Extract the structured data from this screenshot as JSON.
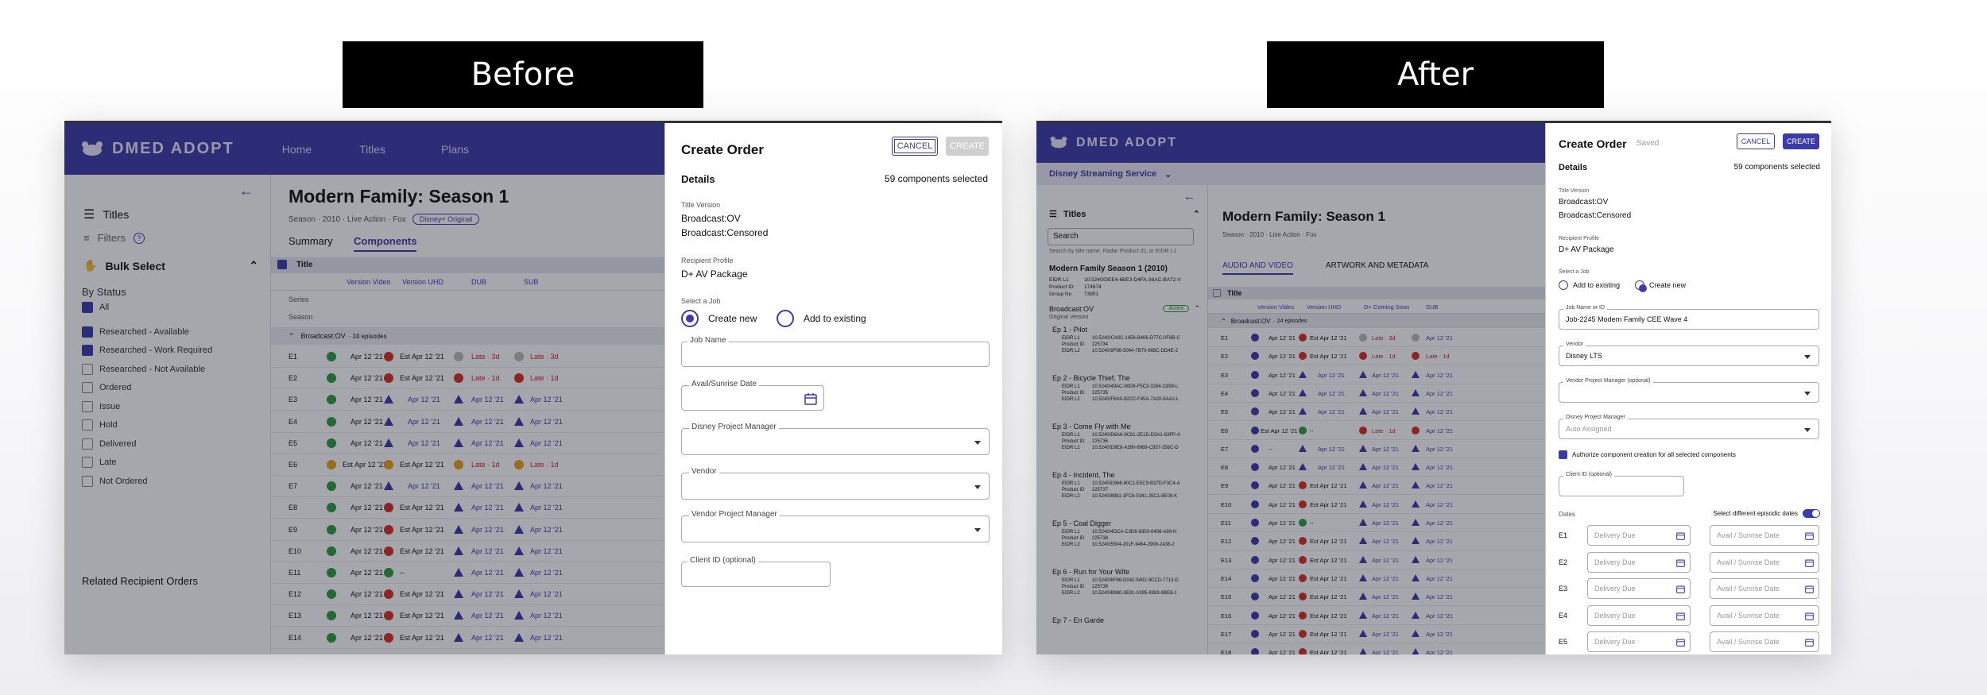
{
  "labels": {
    "before": "Before",
    "after": "After"
  },
  "colors": {
    "brand": "#3d3ba8",
    "ok": "#2a9d3a",
    "err": "#d93025",
    "warn": "#e8a317",
    "late": "#c62828"
  },
  "before": {
    "app_name": "DMED ADOPT",
    "nav": [
      "Home",
      "Titles",
      "Plans"
    ],
    "sidebar": {
      "titles": "Titles",
      "filters": "Filters",
      "bulk_select": "Bulk Select",
      "by_status": "By Status",
      "statuses": [
        {
          "label": "All",
          "checked": true
        },
        {
          "label": "Researched - Available",
          "checked": true
        },
        {
          "label": "Researched - Work Required",
          "checked": true
        },
        {
          "label": "Researched - Not Available",
          "checked": false
        },
        {
          "label": "Ordered",
          "checked": false
        },
        {
          "label": "Issue",
          "checked": false
        },
        {
          "label": "Hold",
          "checked": false
        },
        {
          "label": "Delivered",
          "checked": false
        },
        {
          "label": "Late",
          "checked": false
        },
        {
          "label": "Not Ordered",
          "checked": false
        }
      ],
      "related": "Related Recipient Orders"
    },
    "main": {
      "title": "Modern Family: Season 1",
      "meta": "Season · 2010 · Live Action · Fox",
      "badge": "Disney+ Original",
      "tabs": [
        "Summary",
        "Components"
      ],
      "col_title": "Title",
      "columns": [
        "Version Video",
        "Version UHD",
        "DUB",
        "SUB"
      ],
      "series": "Series",
      "season": "Season",
      "group": "Broadcast:OV",
      "group_count": "· 24 episodes",
      "rows": [
        {
          "ep": "E1",
          "video": "Apr 12 '21",
          "uhd": "Est Apr 12 '21",
          "dub": "Late · 3d",
          "sub": "Late · 3d",
          "vs": "ok",
          "us": "err",
          "ds": "grey"
        },
        {
          "ep": "E2",
          "video": "Apr 12 '21",
          "uhd": "Est Apr 12 '21",
          "dub": "Late · 1d",
          "sub": "Late · 1d",
          "vs": "ok",
          "us": "err",
          "ds": "err"
        },
        {
          "ep": "E3",
          "video": "Apr 12 '21",
          "uhd": "Apr 12 '21",
          "dub": "Apr 12 '21",
          "sub": "Apr 12 '21",
          "vs": "ok",
          "us": "tri",
          "ds": "tri"
        },
        {
          "ep": "E4",
          "video": "Apr 12 '21",
          "uhd": "Apr 12 '21",
          "dub": "Apr 12 '21",
          "sub": "Apr 12 '21",
          "vs": "ok",
          "us": "tri",
          "ds": "tri"
        },
        {
          "ep": "E5",
          "video": "Apr 12 '21",
          "uhd": "Apr 12 '21",
          "dub": "Apr 12 '21",
          "sub": "Apr 12 '21",
          "vs": "ok",
          "us": "tri",
          "ds": "tri"
        },
        {
          "ep": "E6",
          "video": "Est Apr 12 '21",
          "uhd": "Est Apr 12 '21",
          "dub": "Late · 1d",
          "sub": "Late · 1d",
          "vs": "warn",
          "us": "warn",
          "ds": "warn"
        },
        {
          "ep": "E7",
          "video": "Apr 12 '21",
          "uhd": "Apr 12 '21",
          "dub": "Apr 12 '21",
          "sub": "Apr 12 '21",
          "vs": "ok",
          "us": "tri",
          "ds": "tri"
        },
        {
          "ep": "E8",
          "video": "Apr 12 '21",
          "uhd": "Est Apr 12 '21",
          "dub": "Apr 12 '21",
          "sub": "Apr 12 '21",
          "vs": "ok",
          "us": "err",
          "ds": "tri"
        },
        {
          "ep": "E9",
          "video": "Apr 12 '21",
          "uhd": "Est Apr 12 '21",
          "dub": "Apr 12 '21",
          "sub": "Apr 12 '21",
          "vs": "ok",
          "us": "err",
          "ds": "tri"
        },
        {
          "ep": "E10",
          "video": "Apr 12 '21",
          "uhd": "Est Apr 12 '21",
          "dub": "Apr 12 '21",
          "sub": "Apr 12 '21",
          "vs": "ok",
          "us": "err",
          "ds": "tri"
        },
        {
          "ep": "E11",
          "video": "Apr 12 '21",
          "uhd": "--",
          "dub": "Apr 12 '21",
          "sub": "Apr 12 '21",
          "vs": "ok",
          "us": "ok",
          "ds": "tri"
        },
        {
          "ep": "E12",
          "video": "Apr 12 '21",
          "uhd": "Est Apr 12 '21",
          "dub": "Apr 12 '21",
          "sub": "Apr 12 '21",
          "vs": "ok",
          "us": "err",
          "ds": "tri"
        },
        {
          "ep": "E13",
          "video": "Apr 12 '21",
          "uhd": "Est Apr 12 '21",
          "dub": "Apr 12 '21",
          "sub": "Apr 12 '21",
          "vs": "ok",
          "us": "err",
          "ds": "tri"
        },
        {
          "ep": "E14",
          "video": "Apr 12 '21",
          "uhd": "Est Apr 12 '21",
          "dub": "Apr 12 '21",
          "sub": "Apr 12 '21",
          "vs": "ok",
          "us": "err",
          "ds": "tri"
        }
      ]
    },
    "panel": {
      "title": "Create Order",
      "cancel": "CANCEL",
      "create": "CREATE",
      "details": "Details",
      "selected": "59 components selected",
      "title_version_label": "Title Version",
      "title_versions": [
        "Broadcast:OV",
        "Broadcast:Censored"
      ],
      "recipient_label": "Recipient Profile",
      "recipient": "D+ AV Package",
      "select_job": "Select a Job",
      "create_new": "Create new",
      "add_existing": "Add to existing",
      "job_name": "Job Name",
      "avail_date": "Avail/Sunrise Date",
      "dpm": "Disney Project Manager",
      "vendor": "Vendor",
      "vpm": "Vendor Project Manager",
      "client_id": "Client ID (optional)"
    }
  },
  "after": {
    "app_name": "DMED ADOPT",
    "service": "Disney Streaming Service",
    "sidebar": {
      "titles": "Titles",
      "search_value": "Search",
      "search_hint": "Search by title name, Radar Product ID, or EIDR L1",
      "show": "Modern Family Season 1 (2010)",
      "meta_keys": [
        "EIDR L1",
        "Product ID",
        "Group No"
      ],
      "meta_vals": [
        "10.5240/DEE4-6BE3-D4FA-36AC-BA72-V",
        "174674",
        "73901"
      ],
      "group": "Broadcast:OV",
      "group_badge": "Active",
      "group_sub": "Original Version",
      "episodes": [
        {
          "name": "Ep 1 - Pilot",
          "eidr1": "10.5240/CA0C-1056-B406-D77C-0F8B-C",
          "pid": "225734",
          "eidr2": "10.5240/9F86-5064-7B70-668C-DD4E-2"
        },
        {
          "name": "Ep 2 - Bicycle Thief, The",
          "eidr1": "10.5240/49AC-90D6-F5C3-3284-C899-L",
          "pid": "225735",
          "eidr2": "10.5240/F6A9-92CC-F45A-7A20-6AA2-L"
        },
        {
          "name": "Ep 3 - Come Fly with Me",
          "eidr1": "10.5240/D6A6-9C81-2E1D-D3A1-63FP-A",
          "pid": "225736",
          "eidr2": "10.5240/D9E8-A390-9989-C937-358C-D"
        },
        {
          "name": "Ep 4 - Incident, The",
          "eidr1": "10.5240/D966-80C1-E5C9-B37D-F3C4-A",
          "pid": "225737",
          "eidr2": "10.5240/8881-1FC6-5341-25C1-8E08-K"
        },
        {
          "name": "Ep 5 - Coal Digger",
          "eidr1": "10.5240/4DCA-C3D6-8303-6408-A99-H",
          "pid": "225738",
          "eidr2": "10.5240/5504-201F-9464-2908-2438-2"
        },
        {
          "name": "Ep 6 - Run for Your Wife",
          "eidr1": "10.5240/6F86-D042-5402-9CCD-7713-D",
          "pid": "225739",
          "eidr2": "10.5240/B980-3E91-A395-8383-8BE8-1"
        },
        {
          "name": "Ep 7 - En Garde",
          "eidr1": "",
          "pid": "",
          "eidr2": ""
        }
      ]
    },
    "main": {
      "title": "Modern Family: Season 1",
      "meta": "Season · 2010 · Live Action · Fox",
      "tabs": [
        "AUDIO AND VIDEO",
        "ARTWORK AND METADATA"
      ],
      "col_title": "Title",
      "columns": [
        "Version Video",
        "Version UHD",
        "D+ Coming Soon",
        "SUB"
      ],
      "group": "Broadcast:OV",
      "group_count": "· 24 episodes",
      "rows": [
        {
          "ep": "E1",
          "video": "Apr 12 '21",
          "uhd": "Est Apr 12 '21",
          "cs": "Late · 3d",
          "sub": "Apr 12 '21",
          "vs": "ok",
          "us": "err",
          "cst": "grey"
        },
        {
          "ep": "E2",
          "video": "Apr 12 '21",
          "uhd": "Est Apr 12 '21",
          "cs": "Late · 1d",
          "sub": "Late · 1d",
          "vs": "ok",
          "us": "err",
          "cst": "err"
        },
        {
          "ep": "E3",
          "video": "Apr 12 '21",
          "uhd": "Apr 12 '21",
          "cs": "Apr 12 '21",
          "sub": "Apr 12 '21",
          "vs": "ok",
          "us": "tri",
          "cst": "tri"
        },
        {
          "ep": "E4",
          "video": "Apr 12 '21",
          "uhd": "Apr 12 '21",
          "cs": "Apr 12 '21",
          "sub": "Apr 12 '21",
          "vs": "ok",
          "us": "tri",
          "cst": "tri"
        },
        {
          "ep": "E5",
          "video": "Apr 12 '21",
          "uhd": "Apr 12 '21",
          "cs": "Apr 12 '21",
          "sub": "Apr 12 '21",
          "vs": "ok",
          "us": "tri",
          "cst": "tri"
        },
        {
          "ep": "E6",
          "video": "Est Apr 12 '21",
          "uhd": "--",
          "cs": "Late · 1d",
          "sub": "Apr 12 '21",
          "vs": "ok",
          "us": "ok",
          "cst": "err"
        },
        {
          "ep": "E7",
          "video": "--",
          "uhd": "Apr 12 '21",
          "cs": "Apr 12 '21",
          "sub": "Apr 12 '21",
          "vs": "ok",
          "us": "tri",
          "cst": "tri"
        },
        {
          "ep": "E8",
          "video": "Apr 12 '21",
          "uhd": "Apr 12 '21",
          "cs": "Apr 12 '21",
          "sub": "Apr 12 '21",
          "vs": "ok",
          "us": "tri",
          "cst": "tri"
        },
        {
          "ep": "E9",
          "video": "Apr 12 '21",
          "uhd": "Est Apr 12 '21",
          "cs": "Apr 12 '21",
          "sub": "Apr 12 '21",
          "vs": "ok",
          "us": "err",
          "cst": "tri"
        },
        {
          "ep": "E10",
          "video": "Apr 12 '21",
          "uhd": "Est Apr 12 '21",
          "cs": "Apr 12 '21",
          "sub": "Apr 12 '21",
          "vs": "ok",
          "us": "err",
          "cst": "tri"
        },
        {
          "ep": "E11",
          "video": "Apr 12 '21",
          "uhd": "--",
          "cs": "Apr 12 '21",
          "sub": "Apr 12 '21",
          "vs": "ok",
          "us": "ok",
          "cst": "tri"
        },
        {
          "ep": "E12",
          "video": "Apr 12 '21",
          "uhd": "Est Apr 12 '21",
          "cs": "Apr 12 '21",
          "sub": "Apr 12 '21",
          "vs": "ok",
          "us": "err",
          "cst": "tri"
        },
        {
          "ep": "E13",
          "video": "Apr 12 '21",
          "uhd": "Est Apr 12 '21",
          "cs": "Apr 12 '21",
          "sub": "Apr 12 '21",
          "vs": "ok",
          "us": "err",
          "cst": "tri"
        },
        {
          "ep": "E14",
          "video": "Apr 12 '21",
          "uhd": "Est Apr 12 '21",
          "cs": "Apr 12 '21",
          "sub": "Apr 12 '21",
          "vs": "ok",
          "us": "err",
          "cst": "tri"
        },
        {
          "ep": "E15",
          "video": "Apr 12 '21",
          "uhd": "Est Apr 12 '21",
          "cs": "Apr 12 '21",
          "sub": "Apr 12 '21",
          "vs": "ok",
          "us": "err",
          "cst": "tri"
        },
        {
          "ep": "E16",
          "video": "Apr 12 '21",
          "uhd": "Est Apr 12 '21",
          "cs": "Apr 12 '21",
          "sub": "Apr 12 '21",
          "vs": "ok",
          "us": "err",
          "cst": "tri"
        },
        {
          "ep": "E17",
          "video": "Apr 12 '21",
          "uhd": "Est Apr 12 '21",
          "cs": "Apr 12 '21",
          "sub": "Apr 12 '21",
          "vs": "ok",
          "us": "err",
          "cst": "tri"
        },
        {
          "ep": "E18",
          "video": "Apr 12 '21",
          "uhd": "Est Apr 12 '21",
          "cs": "Apr 12 '21",
          "sub": "Apr 12 '21",
          "vs": "ok",
          "us": "err",
          "cst": "tri"
        }
      ]
    },
    "panel": {
      "title": "Create Order",
      "saved": "Saved",
      "cancel": "CANCEL",
      "create": "CREATE",
      "details": "Details",
      "selected": "59 components selected",
      "title_version_label": "Title Version",
      "title_versions": [
        "Broadcast:OV",
        "Broadcast:Censored"
      ],
      "recipient_label": "Recipient Profile",
      "recipient": "D+ AV Package",
      "select_job": "Select a Job",
      "add_existing": "Add to existing",
      "create_new": "Create new",
      "job_label": "Job Name or ID",
      "job_value": "Job-2245 Modern Family CEE Wave 4",
      "vendor_label": "Vendor",
      "vendor_value": "Disney LTS",
      "vpm": "Vendor Project Manager (optional)",
      "dpm_label": "Disney Project Manager",
      "dpm_value": "Auto Assigned",
      "authorize": "Authorize component creation for all selected components",
      "client_id": "Client ID (optional)",
      "dates": "Dates",
      "diff_dates": "Select different episodic dates",
      "delivery_ph": "Delivery Due",
      "avail_ph": "Avail / Sunrise Date",
      "date_eps": [
        "E1",
        "E2",
        "E3",
        "E4",
        "E5"
      ]
    }
  }
}
